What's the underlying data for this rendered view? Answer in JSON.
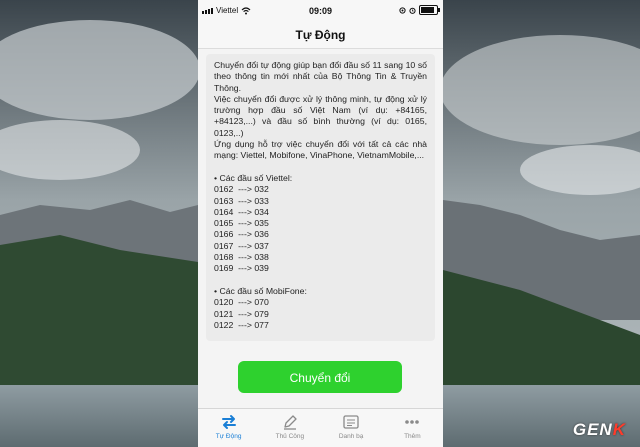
{
  "statusbar": {
    "carrier": "Viettel",
    "time": "09:09"
  },
  "navbar": {
    "title": "Tự Động"
  },
  "content": {
    "intro": "Chuyển đổi tự động giúp bạn đổi đầu số 11 sang 10 số theo thông tin mới nhất của Bộ Thông Tin & Truyền Thông.",
    "smart": "Việc chuyển đổi được xử lý thông minh, tự động xử lý trường hợp đầu số Việt Nam (ví dụ: +84165, +84123,...) và đầu số bình thường (ví dụ: 0165, 0123,..)",
    "support": "Ứng dụng hỗ trợ việc chuyển đổi với tất cả các nhà mạng: Viettel, Mobifone, VinaPhone, VietnamMobile,...",
    "viettel_heading": "• Các đầu số Viettel:",
    "viettel_lines": [
      "0162  ---> 032",
      "0163  ---> 033",
      "0164  ---> 034",
      "0165  ---> 035",
      "0166  ---> 036",
      "0167  ---> 037",
      "0168  ---> 038",
      "0169  ---> 039"
    ],
    "mobifone_heading": "• Các đầu số MobiFone:",
    "mobifone_lines": [
      "0120  ---> 070",
      "0121  ---> 079",
      "0122  ---> 077"
    ]
  },
  "convert_button": {
    "label": "Chuyển đổi",
    "color": "#2ed12e"
  },
  "tabbar": {
    "tabs": [
      {
        "label": "Tự Động",
        "icon": "swap-arrows-icon",
        "active": true
      },
      {
        "label": "Thủ Công",
        "icon": "pencil-icon",
        "active": false
      },
      {
        "label": "Danh bạ",
        "icon": "contacts-icon",
        "active": false
      },
      {
        "label": "Thêm",
        "icon": "more-dots-icon",
        "active": false
      }
    ],
    "active_color": "#1a7fd6"
  },
  "watermark": {
    "left": "GEN",
    "right": "K"
  }
}
